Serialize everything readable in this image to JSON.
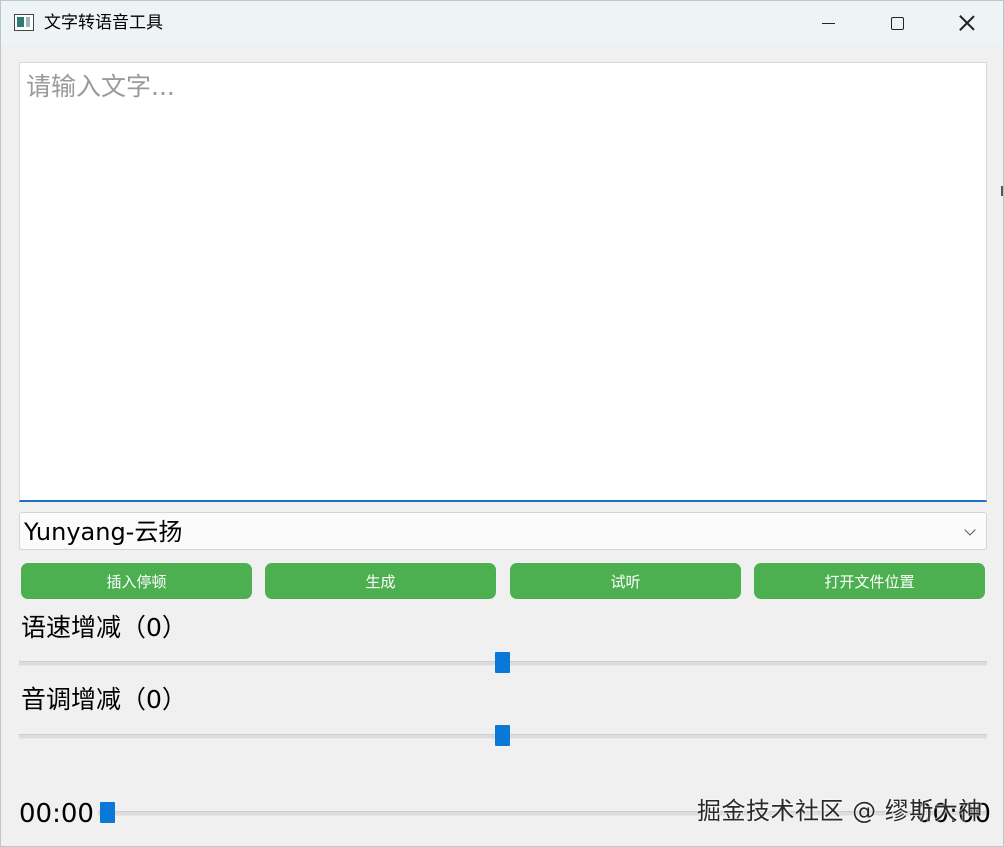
{
  "window": {
    "title": "文字转语音工具"
  },
  "editor": {
    "placeholder": "请输入文字...",
    "value": ""
  },
  "voice": {
    "selected": "Yunyang-云扬"
  },
  "buttons": {
    "insert_pause": "插入停顿",
    "generate": "生成",
    "preview": "试听",
    "open_location": "打开文件位置"
  },
  "speed": {
    "label": "语速增减（0）",
    "value": 0
  },
  "pitch": {
    "label": "音调增减（0）",
    "value": 0
  },
  "player": {
    "current_time": "00:00",
    "total_time": "00:00",
    "progress": 0
  },
  "watermark": "掘金技术社区 @ 缪斯大神",
  "colors": {
    "button_bg": "#4caf50",
    "slider_handle": "#0a78d7",
    "focus_underline": "#1f6fc7"
  }
}
